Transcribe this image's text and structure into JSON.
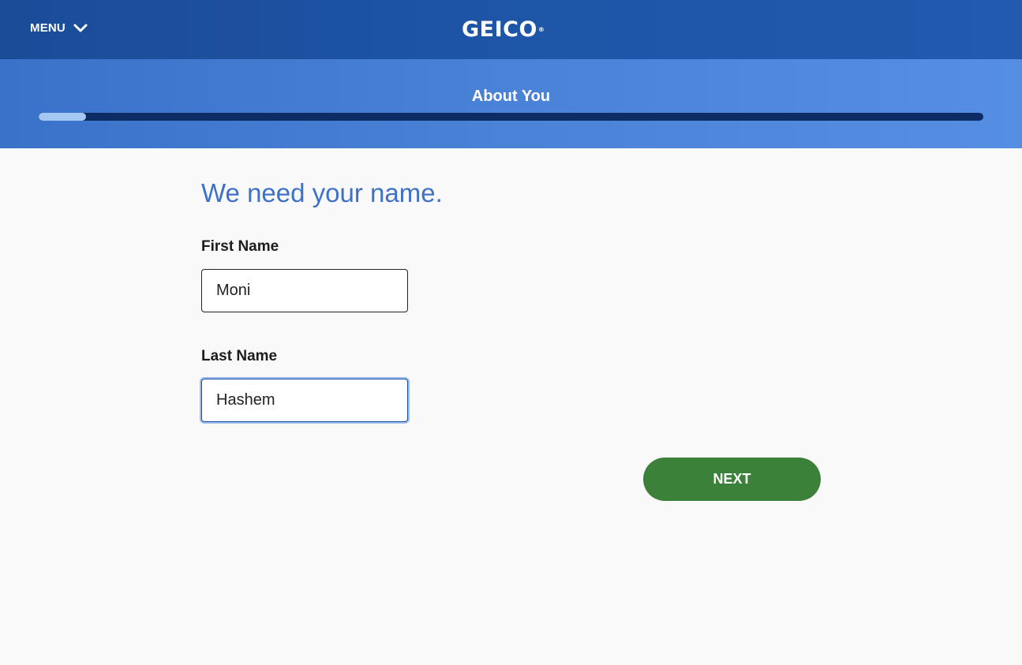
{
  "header": {
    "menu_label": "MENU",
    "menu_icon": "chevron-down-icon",
    "logo_text": "GEICO",
    "logo_mark": "®",
    "colors": {
      "bar": "#1e56a8"
    }
  },
  "progress": {
    "section_title": "About You",
    "fraction_complete": 0.05,
    "colors": {
      "track": "#0c2c63",
      "fill": "#a5c8f2",
      "band": "#4a82d8"
    }
  },
  "form": {
    "heading": "We need your name.",
    "first_name": {
      "label": "First Name",
      "value": "Moni"
    },
    "last_name": {
      "label": "Last Name",
      "value": "Hashem",
      "focused": true
    },
    "next_label": "NEXT",
    "colors": {
      "heading": "#3d72c8",
      "next_button": "#3b813a"
    }
  }
}
